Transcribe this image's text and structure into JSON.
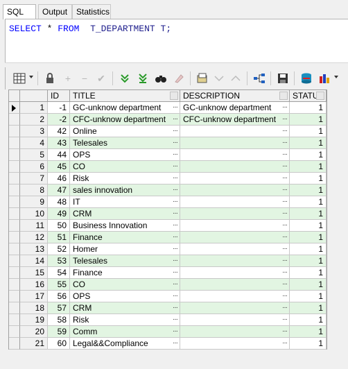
{
  "tabs": [
    {
      "label": "SQL",
      "active": true
    },
    {
      "label": "Output",
      "active": false
    },
    {
      "label": "Statistics",
      "active": false
    }
  ],
  "editor": {
    "kw_select": "SELECT",
    "star": "*",
    "kw_from": "FROM",
    "table": "T_DEPARTMENT",
    "alias": "T;"
  },
  "toolbar": {
    "icons": [
      "grid-view-icon",
      "lock-icon",
      "add-record-icon",
      "delete-record-icon",
      "post-edit-icon",
      "fetch-next-icon",
      "fetch-last-icon",
      "query-by-example-icon",
      "clear-icon",
      "single-record-icon",
      "sort-filter-icon",
      "sort-asc-icon",
      "link-icon",
      "save-icon",
      "export-icon",
      "chart-icon"
    ]
  },
  "grid": {
    "columns": [
      "ID",
      "TITLE",
      "DESCRIPTION",
      "STATUS"
    ],
    "ellipsis": "···",
    "accent_alt_row": "#e2f5e2",
    "rows": [
      {
        "n": "1",
        "id": "-1",
        "title": "GC-unknow department",
        "desc": "GC-unknow department",
        "status": "1"
      },
      {
        "n": "2",
        "id": "-2",
        "title": "CFC-unknow department",
        "desc": "CFC-unknow department",
        "status": "1"
      },
      {
        "n": "3",
        "id": "42",
        "title": "Online",
        "desc": "",
        "status": "1"
      },
      {
        "n": "4",
        "id": "43",
        "title": "Telesales",
        "desc": "",
        "status": "1"
      },
      {
        "n": "5",
        "id": "44",
        "title": "OPS",
        "desc": "",
        "status": "1"
      },
      {
        "n": "6",
        "id": "45",
        "title": "CO",
        "desc": "",
        "status": "1"
      },
      {
        "n": "7",
        "id": "46",
        "title": "Risk",
        "desc": "",
        "status": "1"
      },
      {
        "n": "8",
        "id": "47",
        "title": "sales innovation",
        "desc": "",
        "status": "1"
      },
      {
        "n": "9",
        "id": "48",
        "title": "IT",
        "desc": "",
        "status": "1"
      },
      {
        "n": "10",
        "id": "49",
        "title": "CRM",
        "desc": "",
        "status": "1"
      },
      {
        "n": "11",
        "id": "50",
        "title": "Business Innovation",
        "desc": "",
        "status": "1"
      },
      {
        "n": "12",
        "id": "51",
        "title": "Finance",
        "desc": "",
        "status": "1"
      },
      {
        "n": "13",
        "id": "52",
        "title": "Homer",
        "desc": "",
        "status": "1"
      },
      {
        "n": "14",
        "id": "53",
        "title": "Telesales",
        "desc": "",
        "status": "1"
      },
      {
        "n": "15",
        "id": "54",
        "title": "Finance",
        "desc": "",
        "status": "1"
      },
      {
        "n": "16",
        "id": "55",
        "title": "CO",
        "desc": "",
        "status": "1"
      },
      {
        "n": "17",
        "id": "56",
        "title": "OPS",
        "desc": "",
        "status": "1"
      },
      {
        "n": "18",
        "id": "57",
        "title": "CRM",
        "desc": "",
        "status": "1"
      },
      {
        "n": "19",
        "id": "58",
        "title": "Risk",
        "desc": "",
        "status": "1"
      },
      {
        "n": "20",
        "id": "59",
        "title": "Comm",
        "desc": "",
        "status": "1"
      },
      {
        "n": "21",
        "id": "60",
        "title": "Legal&&Compliance",
        "desc": "",
        "status": "1"
      }
    ]
  }
}
